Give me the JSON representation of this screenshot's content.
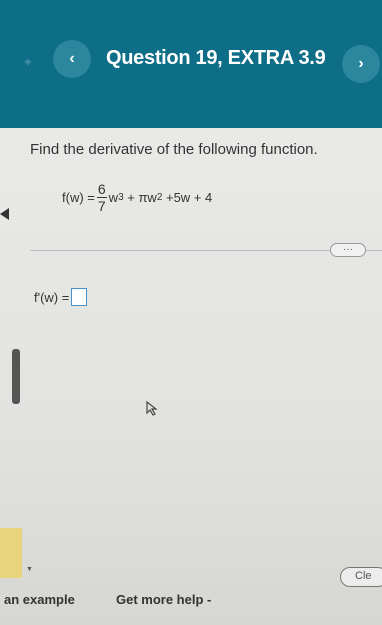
{
  "header": {
    "title": "Question 19, EXTRA 3.9",
    "prev_glyph": "‹",
    "next_glyph": "›",
    "star_glyph": "✦"
  },
  "question": {
    "prompt": "Find the derivative of the following function.",
    "func_lhs": "f(w) =",
    "frac_num": "6",
    "frac_den": "7",
    "term1_var": "w",
    "term1_exp": "3",
    "term2_pre": " + πw",
    "term2_exp": "2",
    "term_rest": " +5w + 4"
  },
  "more_pill": "···",
  "answer": {
    "label": "f'(w) ="
  },
  "footer": {
    "example": "an example",
    "help": "Get more help -",
    "clear": "Cle"
  }
}
